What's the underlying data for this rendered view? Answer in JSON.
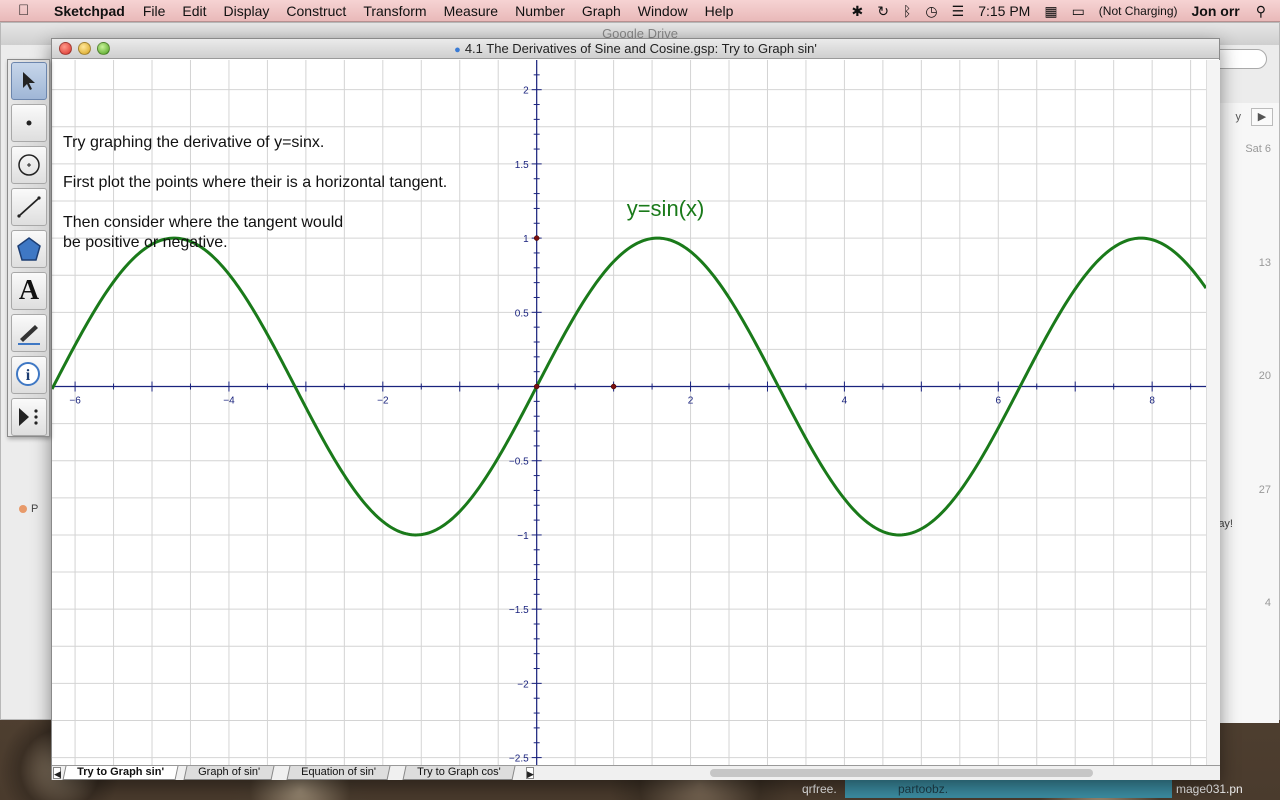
{
  "menubar": {
    "app_name": "Sketchpad",
    "items": [
      "File",
      "Edit",
      "Display",
      "Construct",
      "Transform",
      "Measure",
      "Number",
      "Graph",
      "Window",
      "Help"
    ],
    "time": "7:15 PM",
    "battery_status": "(Not Charging)",
    "user": "Jon orr"
  },
  "background_window": {
    "title": "Google Drive",
    "calendar_header": "Sat 6",
    "calendar_days": [
      "13",
      "20",
      "27",
      "4"
    ],
    "left_label": "P",
    "right_snippet": "ay!",
    "nav_snippet": "y"
  },
  "bottom_labels": {
    "left": "qrfree.",
    "middle": "partoobz.",
    "right": "mage031.pn"
  },
  "sketchpad": {
    "window_title": "4.1 The Derivatives of Sine and Cosine.gsp: Try to Graph sin'",
    "tools": [
      {
        "name": "arrow-tool-icon"
      },
      {
        "name": "point-tool-icon"
      },
      {
        "name": "compass-tool-icon"
      },
      {
        "name": "straightedge-tool-icon"
      },
      {
        "name": "polygon-tool-icon"
      },
      {
        "name": "text-tool-icon"
      },
      {
        "name": "marker-tool-icon"
      },
      {
        "name": "information-tool-icon"
      },
      {
        "name": "custom-tool-icon"
      }
    ],
    "instructions": {
      "line1": "Try graphing the derivative of y=sinx.",
      "line2": "First plot the points where their is a horizontal tangent.",
      "line3a": "Then consider where the tangent would",
      "line3b": "be positive or negative."
    },
    "tabs": [
      {
        "label": "Try to Graph sin'",
        "active": true
      },
      {
        "label": "Graph of sin'",
        "active": false
      },
      {
        "label": "Equation of sin'",
        "active": false
      },
      {
        "label": "Try to Graph cos'",
        "active": false
      }
    ]
  },
  "chart_data": {
    "type": "line",
    "function_label": "y=sin(x)",
    "series": [
      {
        "name": "y=sin(x)",
        "function": "sin(x)",
        "color": "#1a7a1a"
      }
    ],
    "xlim": [
      -6.3,
      8.7
    ],
    "ylim": [
      -2.55,
      2.2
    ],
    "x_tick_labels": [
      "-6",
      "-4",
      "-2",
      "2",
      "4",
      "6",
      "8"
    ],
    "y_tick_labels": [
      "2",
      "1.5",
      "1",
      "0.5",
      "-0.5",
      "-1",
      "-1.5",
      "-2",
      "-2.5"
    ],
    "grid": true,
    "points": [
      {
        "x": 0,
        "y": 1
      },
      {
        "x": 0,
        "y": 0
      },
      {
        "x": 1,
        "y": 0
      }
    ],
    "axis_color": "#1a237e",
    "grid_color": "#d4d4d4"
  }
}
